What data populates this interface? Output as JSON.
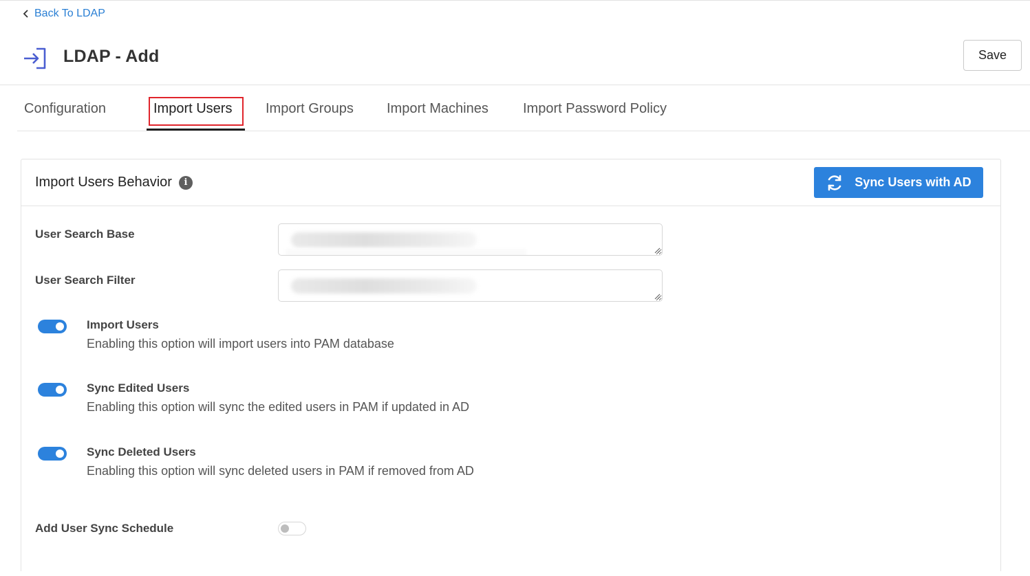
{
  "nav": {
    "back_label": "Back To LDAP"
  },
  "header": {
    "title": "LDAP - Add",
    "save_label": "Save"
  },
  "tabs": [
    {
      "label": "Configuration",
      "active": false
    },
    {
      "label": "Import Users",
      "active": true
    },
    {
      "label": "Import Groups",
      "active": false
    },
    {
      "label": "Import Machines",
      "active": false
    },
    {
      "label": "Import Password Policy",
      "active": false
    }
  ],
  "card": {
    "title": "Import Users Behavior",
    "sync_button_label": "Sync Users with AD",
    "fields": {
      "search_base_label": "User Search Base",
      "search_filter_label": "User Search Filter"
    },
    "toggles": [
      {
        "title": "Import Users",
        "description": "Enabling this option will import users into PAM database",
        "enabled": true
      },
      {
        "title": "Sync Edited Users",
        "description": "Enabling this option will sync the edited users in PAM if updated in AD",
        "enabled": true
      },
      {
        "title": "Sync Deleted Users",
        "description": "Enabling this option will sync deleted users in PAM if removed from AD",
        "enabled": true
      }
    ],
    "schedule": {
      "label": "Add User Sync Schedule",
      "enabled": false
    }
  },
  "colors": {
    "accent": "#2c82dd",
    "link": "#2a7fd4",
    "highlight_box": "#e0242b",
    "header_icon": "#4a5ed1"
  }
}
